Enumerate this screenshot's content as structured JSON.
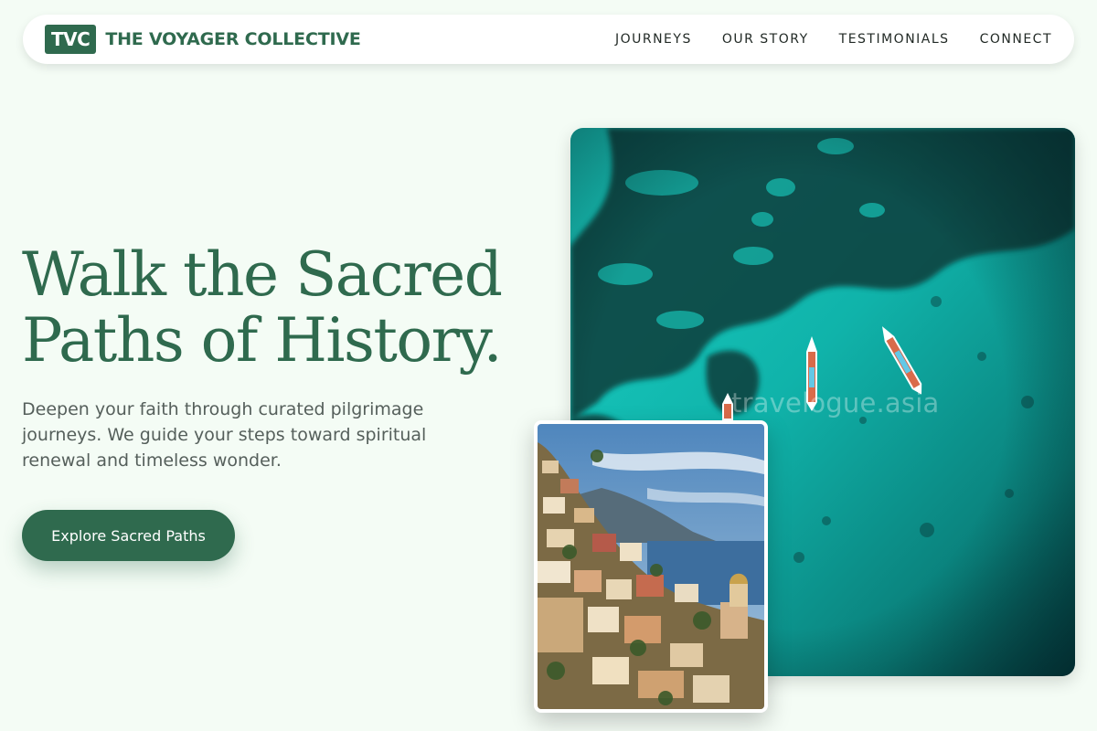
{
  "nav": {
    "logo_badge": "TVC",
    "brand_name": "THE VOYAGER COLLECTIVE",
    "links": [
      "JOURNEYS",
      "OUR STORY",
      "TESTIMONIALS",
      "CONNECT"
    ]
  },
  "hero": {
    "title_line1": "Walk the Sacred",
    "title_line2": "Paths of History.",
    "subtitle": "Deepen your faith through curated pilgrimage journeys. We guide your steps toward spiritual renewal and timeless wonder.",
    "cta_label": "Explore Sacred Paths"
  },
  "images": {
    "sea_watermark": "travelogue.asia"
  },
  "colors": {
    "accent": "#2f6a4e",
    "background": "#f4fcf5",
    "body_text": "#555f5b"
  }
}
